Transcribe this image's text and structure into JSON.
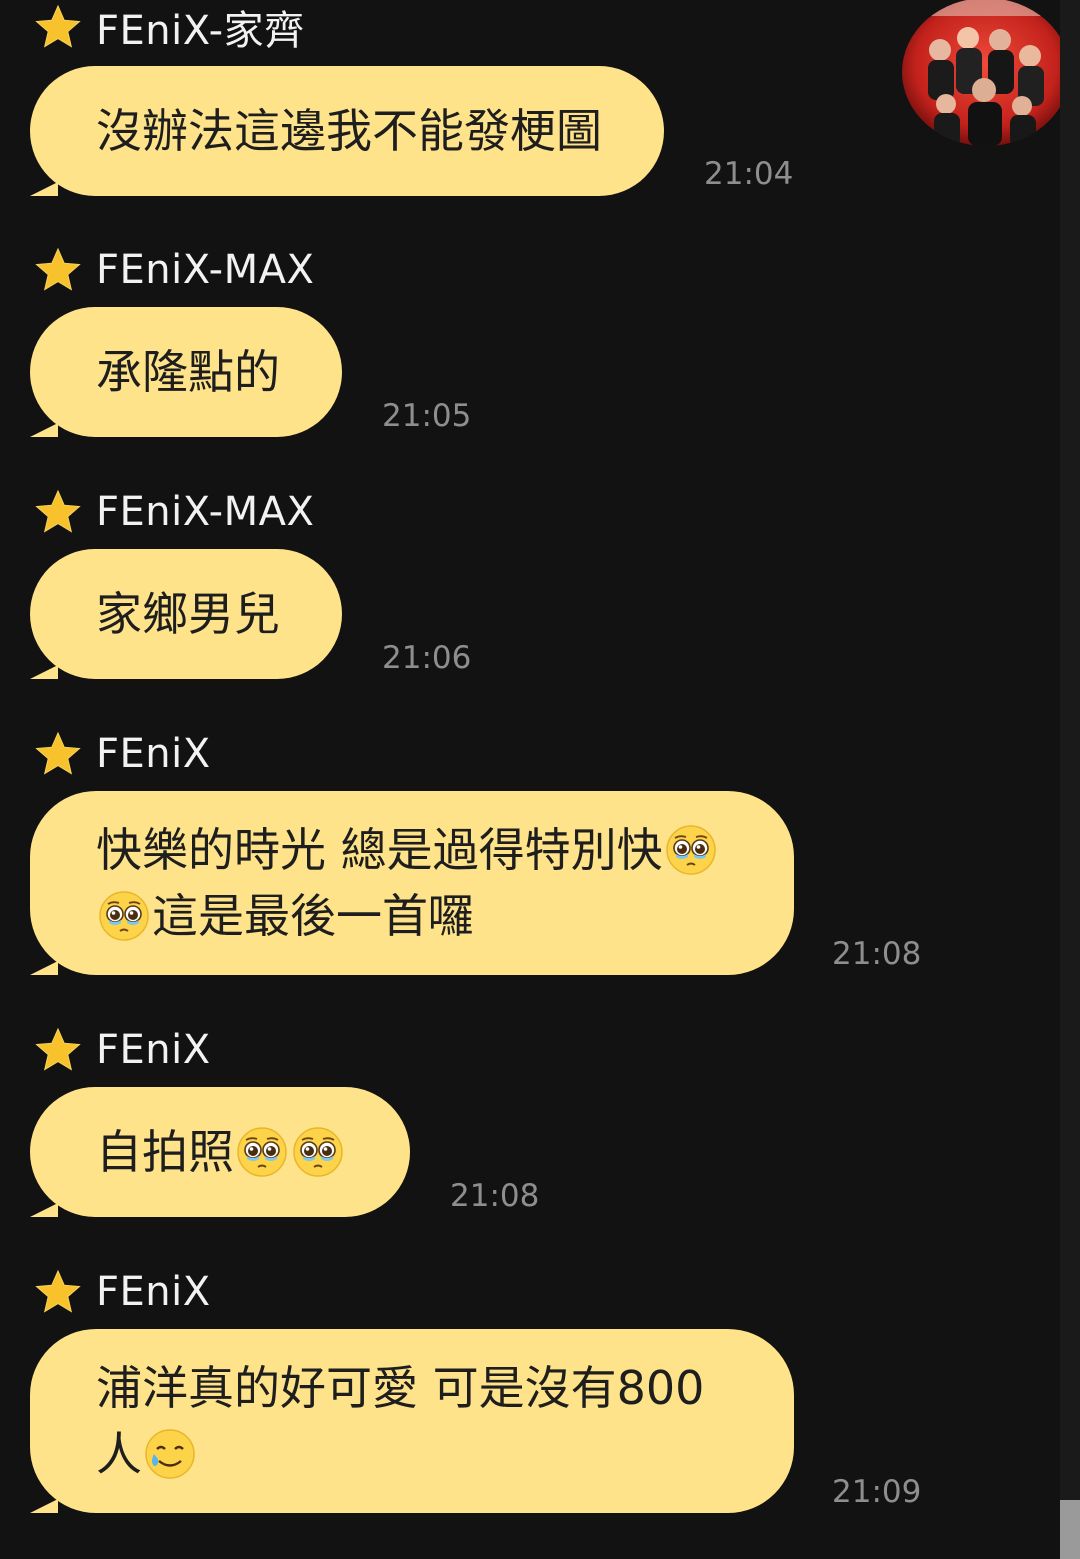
{
  "messages": [
    {
      "sender": "FEniX-家齊",
      "lines": [
        [
          {
            "t": "沒辦法這邊我不能發梗圖"
          }
        ]
      ],
      "time": "21:04"
    },
    {
      "sender": "FEniX-MAX",
      "lines": [
        [
          {
            "t": "承隆點的"
          }
        ]
      ],
      "time": "21:05"
    },
    {
      "sender": "FEniX-MAX",
      "lines": [
        [
          {
            "t": "家鄉男兒"
          }
        ]
      ],
      "time": "21:06"
    },
    {
      "sender": "FEniX",
      "lines": [
        [
          {
            "t": "快樂的時光 總是過得特別快"
          },
          {
            "e": "pleading-face-emoji"
          }
        ],
        [
          {
            "e": "pleading-face-emoji"
          },
          {
            "t": "這是最後一首囉"
          }
        ]
      ],
      "time": "21:08"
    },
    {
      "sender": "FEniX",
      "lines": [
        [
          {
            "t": "自拍照"
          },
          {
            "e": "pleading-face-emoji"
          },
          {
            "e": "pleading-face-emoji"
          }
        ]
      ],
      "time": "21:08"
    },
    {
      "sender": "FEniX",
      "lines": [
        [
          {
            "t": "浦洋真的好可愛 可是沒有800"
          }
        ],
        [
          {
            "t": "人"
          },
          {
            "e": "smiling-face-with-tear-emoji"
          }
        ]
      ],
      "time": "21:09"
    }
  ],
  "avatar": {
    "icon": "group-photo-avatar",
    "bg": "#d8302a"
  },
  "colors": {
    "background": "#121212",
    "bubble": "#fee38a",
    "bubble_text": "#1e1e1e",
    "timestamp": "#8e8e8e",
    "star": "#f7c22b"
  },
  "icons": {
    "sender_badge": "star-icon"
  }
}
